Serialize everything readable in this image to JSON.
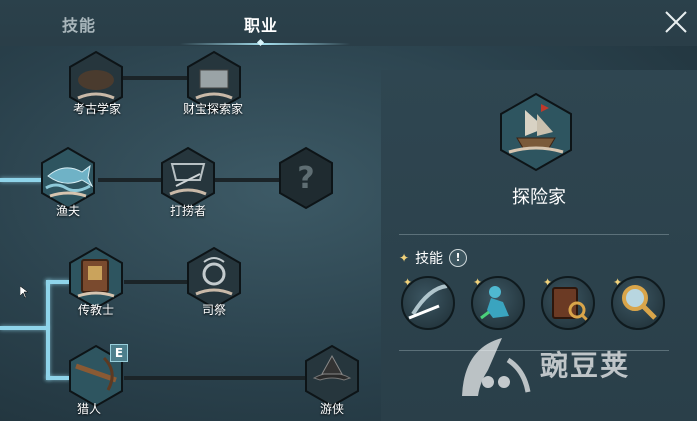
{
  "tabs": [
    {
      "label": "技能",
      "active": false
    },
    {
      "label": "职业",
      "active": true
    }
  ],
  "close_icon": "close-x-icon",
  "career_tree": {
    "nodes": [
      {
        "id": "archaeologist",
        "label": "考古学家",
        "icon": "archaeology-icon"
      },
      {
        "id": "treasure_hunter",
        "label": "财宝探索家",
        "icon": "treasure-chest-icon"
      },
      {
        "id": "fisherman",
        "label": "渔夫",
        "icon": "fish-icon",
        "unlocked": true
      },
      {
        "id": "salvager",
        "label": "打捞者",
        "icon": "net-icon"
      },
      {
        "id": "unknown",
        "label": "?",
        "icon": "question-mark-icon"
      },
      {
        "id": "missionary",
        "label": "传教士",
        "icon": "book-icon",
        "unlocked": true
      },
      {
        "id": "priest",
        "label": "司祭",
        "icon": "crest-icon"
      },
      {
        "id": "hunter",
        "label": "猎人",
        "icon": "crossbow-icon",
        "unlocked": true,
        "badge": "E"
      },
      {
        "id": "ranger",
        "label": "游侠",
        "icon": "hat-icon"
      }
    ]
  },
  "detail_panel": {
    "title": "探险家",
    "emblem_icon": "sailing-ship-icon",
    "skills_heading": "技能",
    "info_label": "!",
    "skills": [
      {
        "icon": "sword-slash-icon"
      },
      {
        "icon": "figure-kneeling-icon"
      },
      {
        "icon": "book-magnifier-icon"
      },
      {
        "icon": "magnifying-glass-icon"
      }
    ]
  },
  "watermark": {
    "text": "豌豆荚"
  },
  "colors": {
    "background": "#2a414c",
    "active_line": "#8fd4ea",
    "inactive_line": "#1b2428",
    "spark": "#f1d27a"
  }
}
